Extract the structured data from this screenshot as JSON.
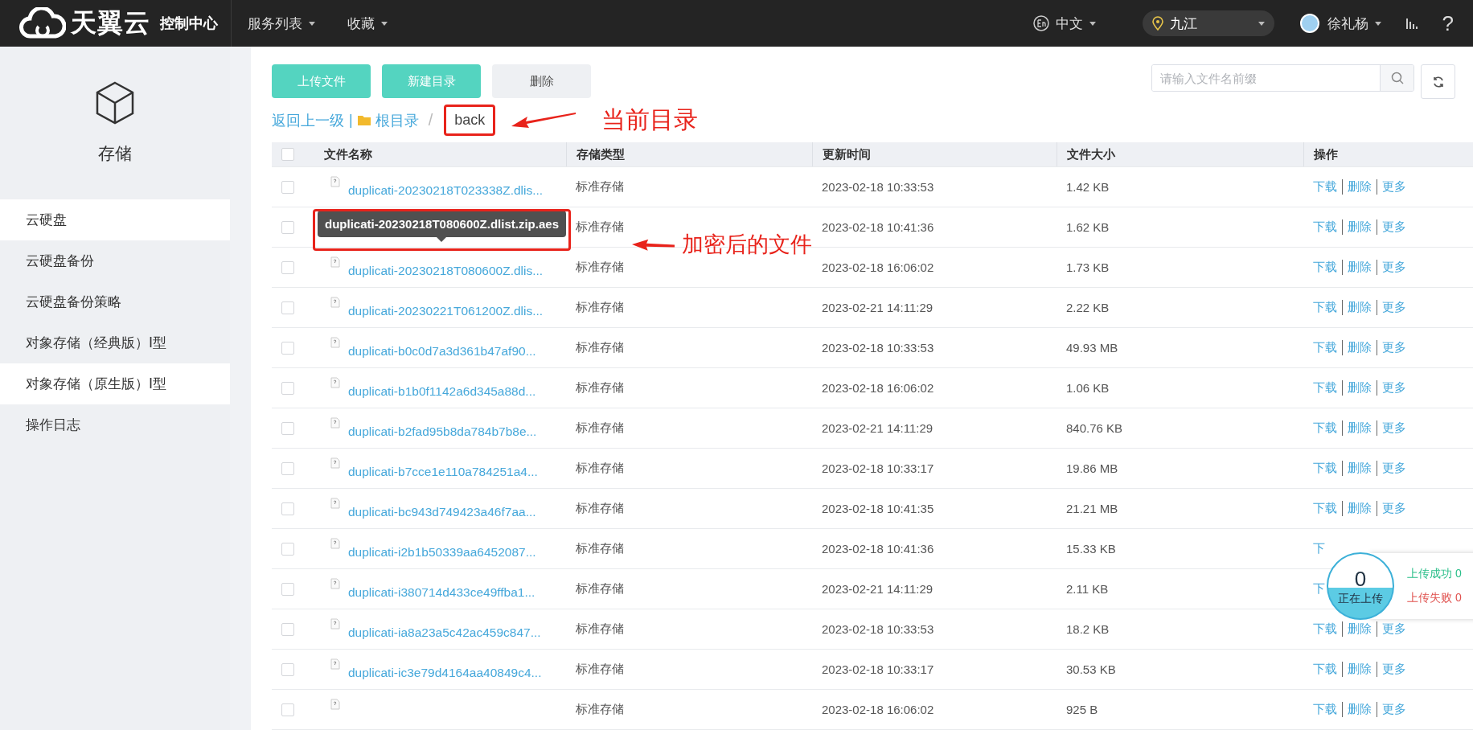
{
  "topbar": {
    "logo_text": "天翼云",
    "console": "控制中心",
    "menus": [
      {
        "label": "服务列表"
      },
      {
        "label": "收藏"
      }
    ],
    "language": "中文",
    "region": "九江",
    "user": "徐礼杨",
    "help": "?"
  },
  "sidebar": {
    "title": "存储",
    "items": [
      {
        "label": "云硬盘",
        "selected": true
      },
      {
        "label": "云硬盘备份",
        "selected": false
      },
      {
        "label": "云硬盘备份策略",
        "selected": false
      },
      {
        "label": "对象存储（经典版）Ⅰ型",
        "selected": false
      },
      {
        "label": "对象存储（原生版）Ⅰ型",
        "selected": true
      },
      {
        "label": "操作日志",
        "selected": false
      }
    ]
  },
  "toolbar": {
    "buttons": [
      {
        "label": "上传文件",
        "kind": "primary"
      },
      {
        "label": "新建目录",
        "kind": "primary"
      },
      {
        "label": "删除",
        "kind": "plain"
      }
    ],
    "search": {
      "placeholder": "请输入文件名前缀"
    }
  },
  "breadcrumb": {
    "back": "返回上一级",
    "separator": "|",
    "root": "根目录",
    "slash": "/",
    "current": "back"
  },
  "table": {
    "header_checked": false,
    "columns": [
      "文件名称",
      "存储类型",
      "更新时间",
      "文件大小",
      "操作"
    ],
    "rows": [
      {
        "checked": false,
        "name": "duplicati-20230218T023338Z.dlis...",
        "type": "标准存储",
        "time": "2023-02-18 10:33:53",
        "size": "1.42 KB",
        "actions": [
          "下载",
          "删除",
          "更多"
        ]
      },
      {
        "checked": false,
        "type": "标准存储",
        "time": "2023-02-18 10:41:36",
        "size": "1.62 KB",
        "tooltip": "duplicati-20230218T080600Z.dlist.zip.aes",
        "actions": [
          "下载",
          "删除",
          "更多"
        ]
      },
      {
        "checked": false,
        "name": "duplicati-20230218T080600Z.dlis...",
        "type": "标准存储",
        "time": "2023-02-18 16:06:02",
        "size": "1.73 KB",
        "actions": [
          "下载",
          "删除",
          "更多"
        ]
      },
      {
        "checked": false,
        "name": "duplicati-20230221T061200Z.dlis...",
        "type": "标准存储",
        "time": "2023-02-21 14:11:29",
        "size": "2.22 KB",
        "actions": [
          "下载",
          "删除",
          "更多"
        ]
      },
      {
        "checked": false,
        "name": "duplicati-b0c0d7a3d361b47af90...",
        "type": "标准存储",
        "time": "2023-02-18 10:33:53",
        "size": "49.93 MB",
        "actions": [
          "下载",
          "删除",
          "更多"
        ]
      },
      {
        "checked": false,
        "name": "duplicati-b1b0f1142a6d345a88d...",
        "type": "标准存储",
        "time": "2023-02-18 16:06:02",
        "size": "1.06 KB",
        "actions": [
          "下载",
          "删除",
          "更多"
        ]
      },
      {
        "checked": false,
        "name": "duplicati-b2fad95b8da784b7b8e...",
        "type": "标准存储",
        "time": "2023-02-21 14:11:29",
        "size": "840.76 KB",
        "actions": [
          "下载",
          "删除",
          "更多"
        ]
      },
      {
        "checked": false,
        "name": "duplicati-b7cce1e110a784251a4...",
        "type": "标准存储",
        "time": "2023-02-18 10:33:17",
        "size": "19.86 MB",
        "actions": [
          "下载",
          "删除",
          "更多"
        ]
      },
      {
        "checked": false,
        "name": "duplicati-bc943d749423a46f7aa...",
        "type": "标准存储",
        "time": "2023-02-18 10:41:35",
        "size": "21.21 MB",
        "actions": [
          "下载",
          "删除",
          "更多"
        ]
      },
      {
        "checked": false,
        "name": "duplicati-i2b1b50339aa6452087...",
        "type": "标准存储",
        "time": "2023-02-18 10:41:36",
        "size": "15.33 KB",
        "actions": [
          "下"
        ]
      },
      {
        "checked": false,
        "name": "duplicati-i380714d433ce49ffba1...",
        "type": "标准存储",
        "time": "2023-02-21 14:11:29",
        "size": "2.11 KB",
        "actions": [
          "下"
        ]
      },
      {
        "checked": false,
        "name": "duplicati-ia8a23a5c42ac459c847...",
        "type": "标准存储",
        "time": "2023-02-18 10:33:53",
        "size": "18.2 KB",
        "actions": [
          "下载",
          "删除",
          "更多"
        ]
      },
      {
        "checked": false,
        "name": "duplicati-ic3e79d4164aa40849c4...",
        "type": "标准存储",
        "time": "2023-02-18 10:33:17",
        "size": "30.53 KB",
        "actions": [
          "下载",
          "删除",
          "更多"
        ]
      },
      {
        "checked": false,
        "type": "标准存储",
        "time": "2023-02-18 16:06:02",
        "size": "925 B",
        "actions": [
          "下载",
          "删除",
          "更多"
        ]
      }
    ]
  },
  "upload_widget": {
    "count": "0",
    "status": "正在上传",
    "success": "上传成功 0",
    "failed": "上传失败 0"
  },
  "annotations": [
    {
      "text": "当前目录"
    },
    {
      "text": "加密后的文件"
    }
  ]
}
